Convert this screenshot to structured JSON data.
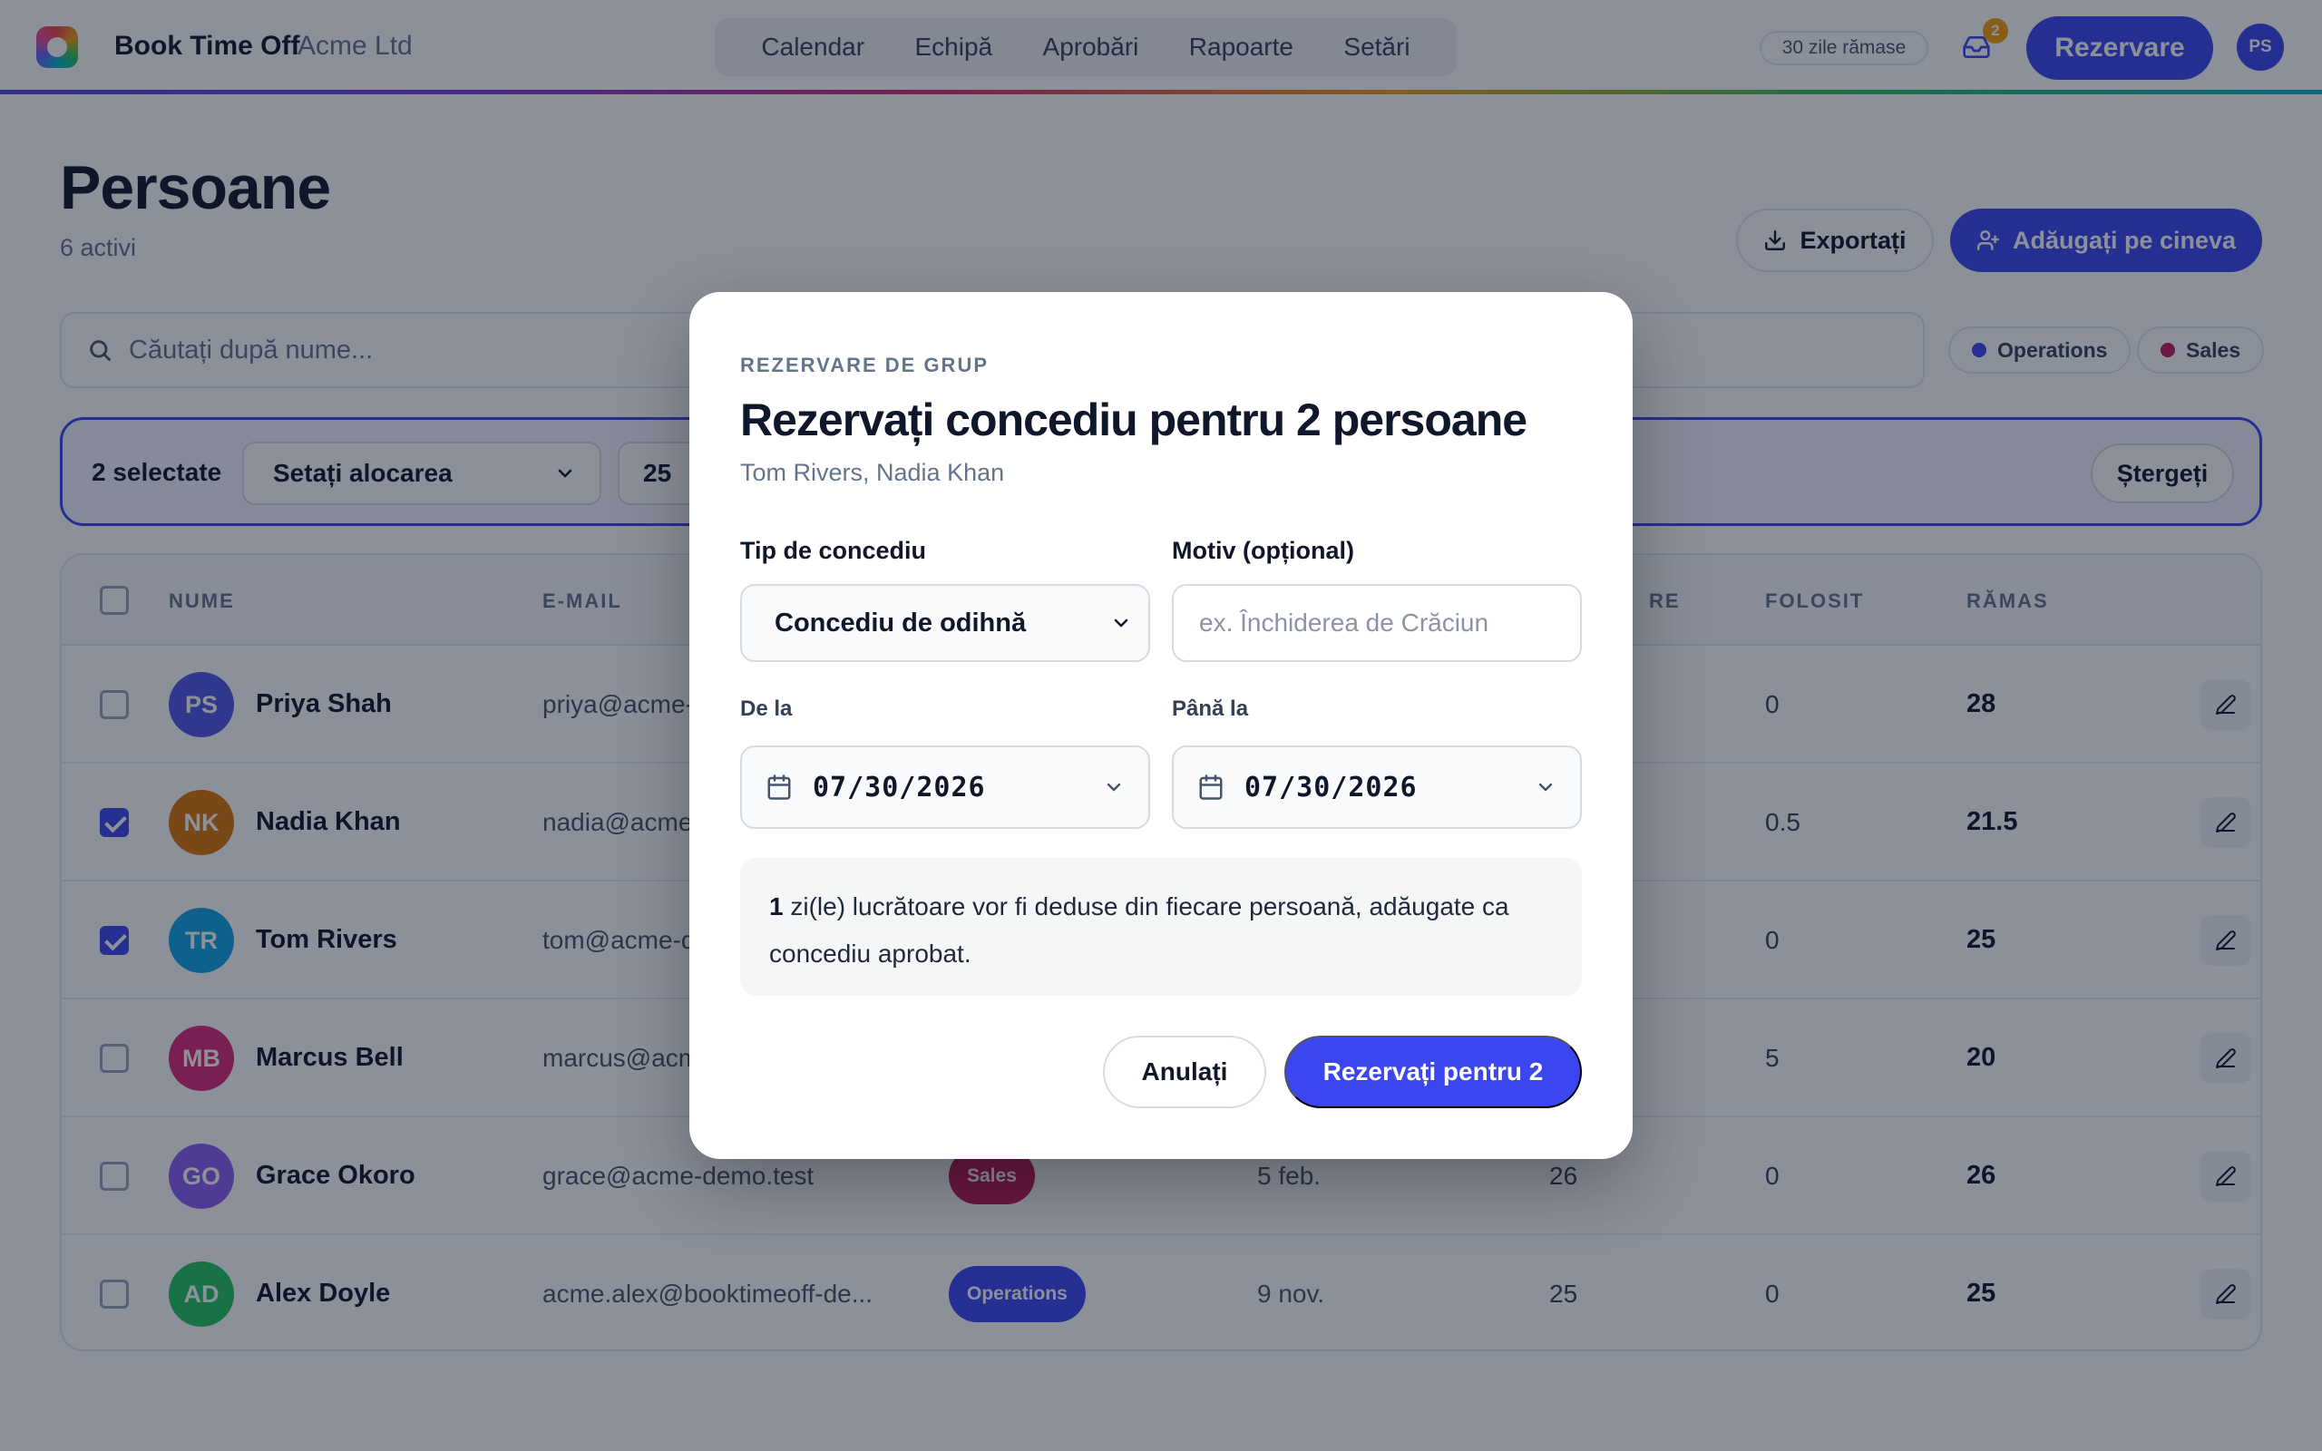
{
  "app": {
    "brand": "Book Time Off",
    "org": "Acme Ltd"
  },
  "nav": {
    "tabs": [
      "Calendar",
      "Echipă",
      "Aprobări",
      "Rapoarte",
      "Setări"
    ]
  },
  "header": {
    "days_left": "30 zile rămase",
    "inbox_count": "2",
    "book_label": "Rezervare",
    "user_initials": "PS"
  },
  "page": {
    "title": "Persoane",
    "subtitle": "6 activi",
    "export_label": "Exportați",
    "add_label": "Adăugați pe cineva"
  },
  "search": {
    "placeholder": "Căutați după nume..."
  },
  "filters": [
    {
      "label": "Operations",
      "color": "#3b46f0"
    },
    {
      "label": "Sales",
      "color": "#c2185b"
    }
  ],
  "bulk": {
    "count_label": "2 selectate",
    "allocation_select": "Setați alocarea",
    "allocation_value": "25",
    "clear_label": "Ștergeți"
  },
  "table": {
    "columns": {
      "name": "NUME",
      "email": "E-MAIL",
      "alloc": "RE",
      "used": "FOLOSIT",
      "remaining": "RĂMAS"
    },
    "rows": [
      {
        "initials": "PS",
        "name": "Priya Shah",
        "email": "priya@acme-",
        "dept": "",
        "start": "",
        "alloc": "",
        "used": "0",
        "remaining": "28",
        "checked": false,
        "avatar_color": "#4f55e8"
      },
      {
        "initials": "NK",
        "name": "Nadia Khan",
        "email": "nadia@acme",
        "dept": "",
        "start": "",
        "alloc": "",
        "used": "0.5",
        "remaining": "21.5",
        "checked": true,
        "avatar_color": "#d97706"
      },
      {
        "initials": "TR",
        "name": "Tom Rivers",
        "email": "tom@acme-d",
        "dept": "",
        "start": "",
        "alloc": "",
        "used": "0",
        "remaining": "25",
        "checked": true,
        "avatar_color": "#0ea5e9"
      },
      {
        "initials": "MB",
        "name": "Marcus Bell",
        "email": "marcus@acm",
        "dept": "",
        "start": "",
        "alloc": "",
        "used": "5",
        "remaining": "20",
        "checked": false,
        "avatar_color": "#db2777"
      },
      {
        "initials": "GO",
        "name": "Grace Okoro",
        "email": "grace@acme-demo.test",
        "dept": "Sales",
        "dept_color": "#c2185b",
        "start": "5 feb.",
        "alloc": "26",
        "used": "0",
        "remaining": "26",
        "checked": false,
        "avatar_color": "#8b5cf6"
      },
      {
        "initials": "AD",
        "name": "Alex Doyle",
        "email": "acme.alex@booktimeoff-de...",
        "dept": "Operations",
        "dept_color": "#3b46f0",
        "start": "9 nov.",
        "alloc": "25",
        "used": "0",
        "remaining": "25",
        "checked": false,
        "avatar_color": "#22c55e"
      }
    ]
  },
  "modal": {
    "eyebrow": "REZERVARE DE GRUP",
    "title": "Rezervați concediu pentru 2 persoane",
    "subtitle": "Tom Rivers, Nadia Khan",
    "type_label": "Tip de concediu",
    "type_value": "Concediu de odihnă",
    "reason_label": "Motiv (opțional)",
    "reason_placeholder": "ex. Închiderea de Crăciun",
    "from_label": "De la",
    "from_value": "07/30/2026",
    "to_label": "Până la",
    "to_value": "07/30/2026",
    "info_count": "1",
    "info_text": " zi(le) lucrătoare vor fi deduse din fiecare persoană, adăugate ca concediu aprobat.",
    "cancel_label": "Anulați",
    "submit_label": "Rezervați pentru 2"
  }
}
